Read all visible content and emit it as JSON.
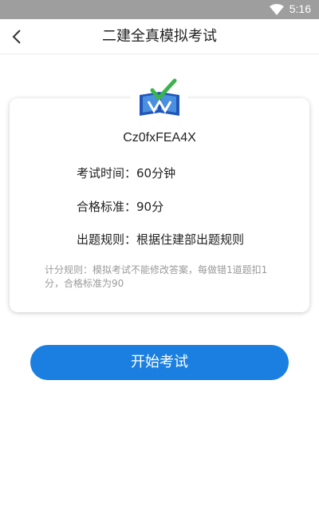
{
  "status_bar": {
    "time": "5:16",
    "wifi_icon": "wifi-icon",
    "background": "#9e9e9e"
  },
  "header": {
    "title": "二建全真模拟考试",
    "back_icon": "chevron-left-icon"
  },
  "card": {
    "logo_icon": "book-checkmark-icon",
    "exam_code": "Cz0fxFEA4X",
    "duration_label": "考试时间：",
    "duration_value": "60分钟",
    "pass_label": "合格标准：",
    "pass_value": "90分",
    "rule_label": "出题规则：",
    "rule_value": "根据住建部出题规则",
    "scoring_note": "计分规则：模拟考试不能修改答案，每做错1道题扣1分，合格标准为90"
  },
  "actions": {
    "start_label": "开始考试",
    "accent": "#1a7fe0"
  }
}
